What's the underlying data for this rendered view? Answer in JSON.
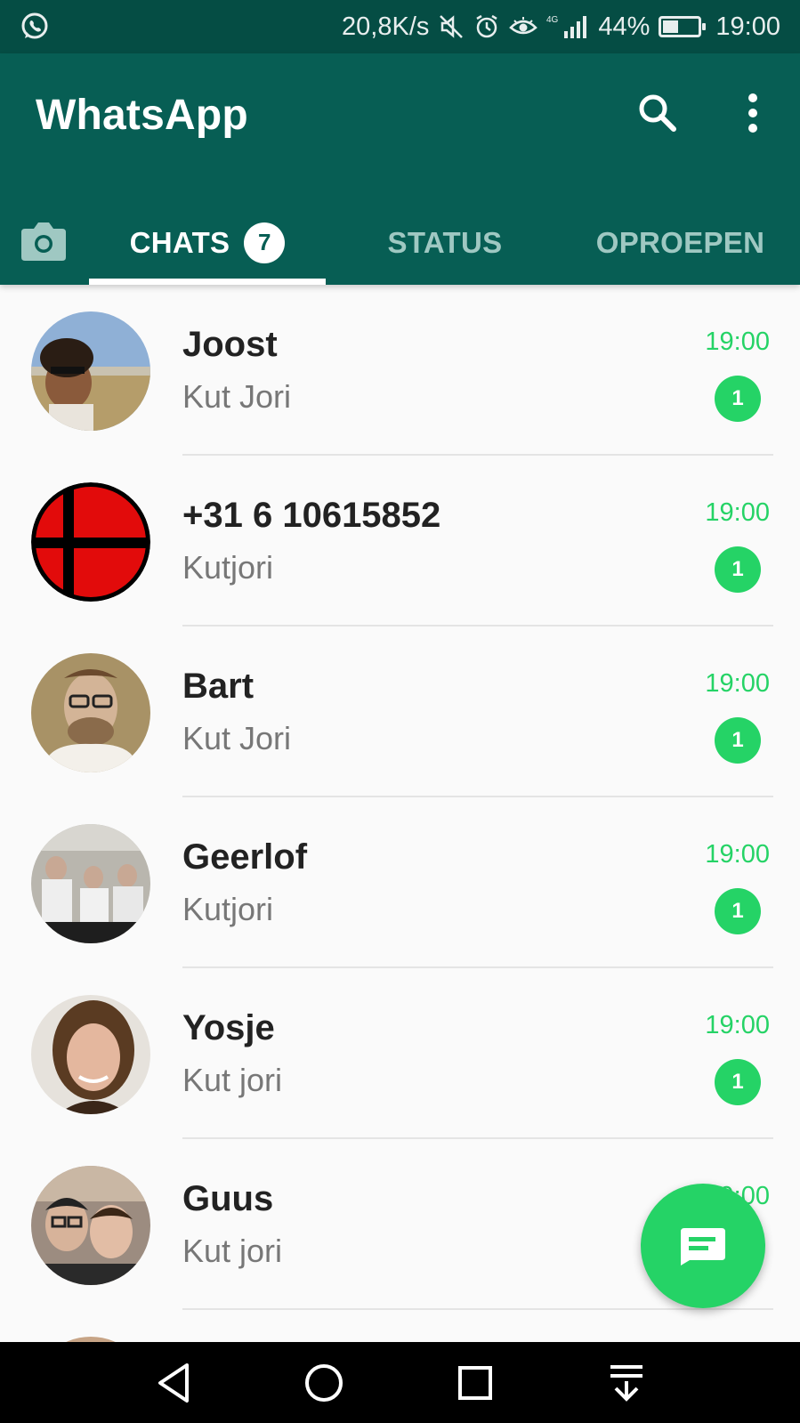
{
  "status_bar": {
    "app_icon": "whatsapp-icon",
    "network_speed": "20,8K/s",
    "icons": [
      "mute-icon",
      "alarm-icon",
      "eye-comfort-icon",
      "signal-4g-icon"
    ],
    "network_type": "4G",
    "battery_percent": "44%",
    "battery_level": 0.44,
    "time": "19:00"
  },
  "app_bar": {
    "title": "WhatsApp",
    "search_icon": "search-icon",
    "more_icon": "more-vert-icon",
    "background_color": "#075e54"
  },
  "tabs": {
    "camera_icon": "camera-icon",
    "items": [
      {
        "label": "CHATS",
        "badge": "7",
        "active": true
      },
      {
        "label": "STATUS",
        "active": false
      },
      {
        "label": "OPROEPEN",
        "active": false
      }
    ]
  },
  "chats": [
    {
      "name": "Joost",
      "message": "Kut Jori",
      "time": "19:00",
      "unread": "1"
    },
    {
      "name": "+31 6 10615852",
      "message": "Kutjori",
      "time": "19:00",
      "unread": "1"
    },
    {
      "name": "Bart",
      "message": "Kut Jori",
      "time": "19:00",
      "unread": "1"
    },
    {
      "name": "Geerlof",
      "message": "Kutjori",
      "time": "19:00",
      "unread": "1"
    },
    {
      "name": "Yosje",
      "message": "Kut jori",
      "time": "19:00",
      "unread": "1"
    },
    {
      "name": "Guus",
      "message": "Kut jori",
      "time": "19:00"
    }
  ],
  "fab": {
    "icon": "new-chat-icon",
    "color": "#25d366"
  },
  "nav_bar": {
    "buttons": [
      "back-icon",
      "home-icon",
      "recents-icon",
      "notification-pull-icon"
    ]
  },
  "colors": {
    "accent": "#25d366",
    "status_bar": "#054d44",
    "tab_inactive": "#9fc8c2"
  }
}
